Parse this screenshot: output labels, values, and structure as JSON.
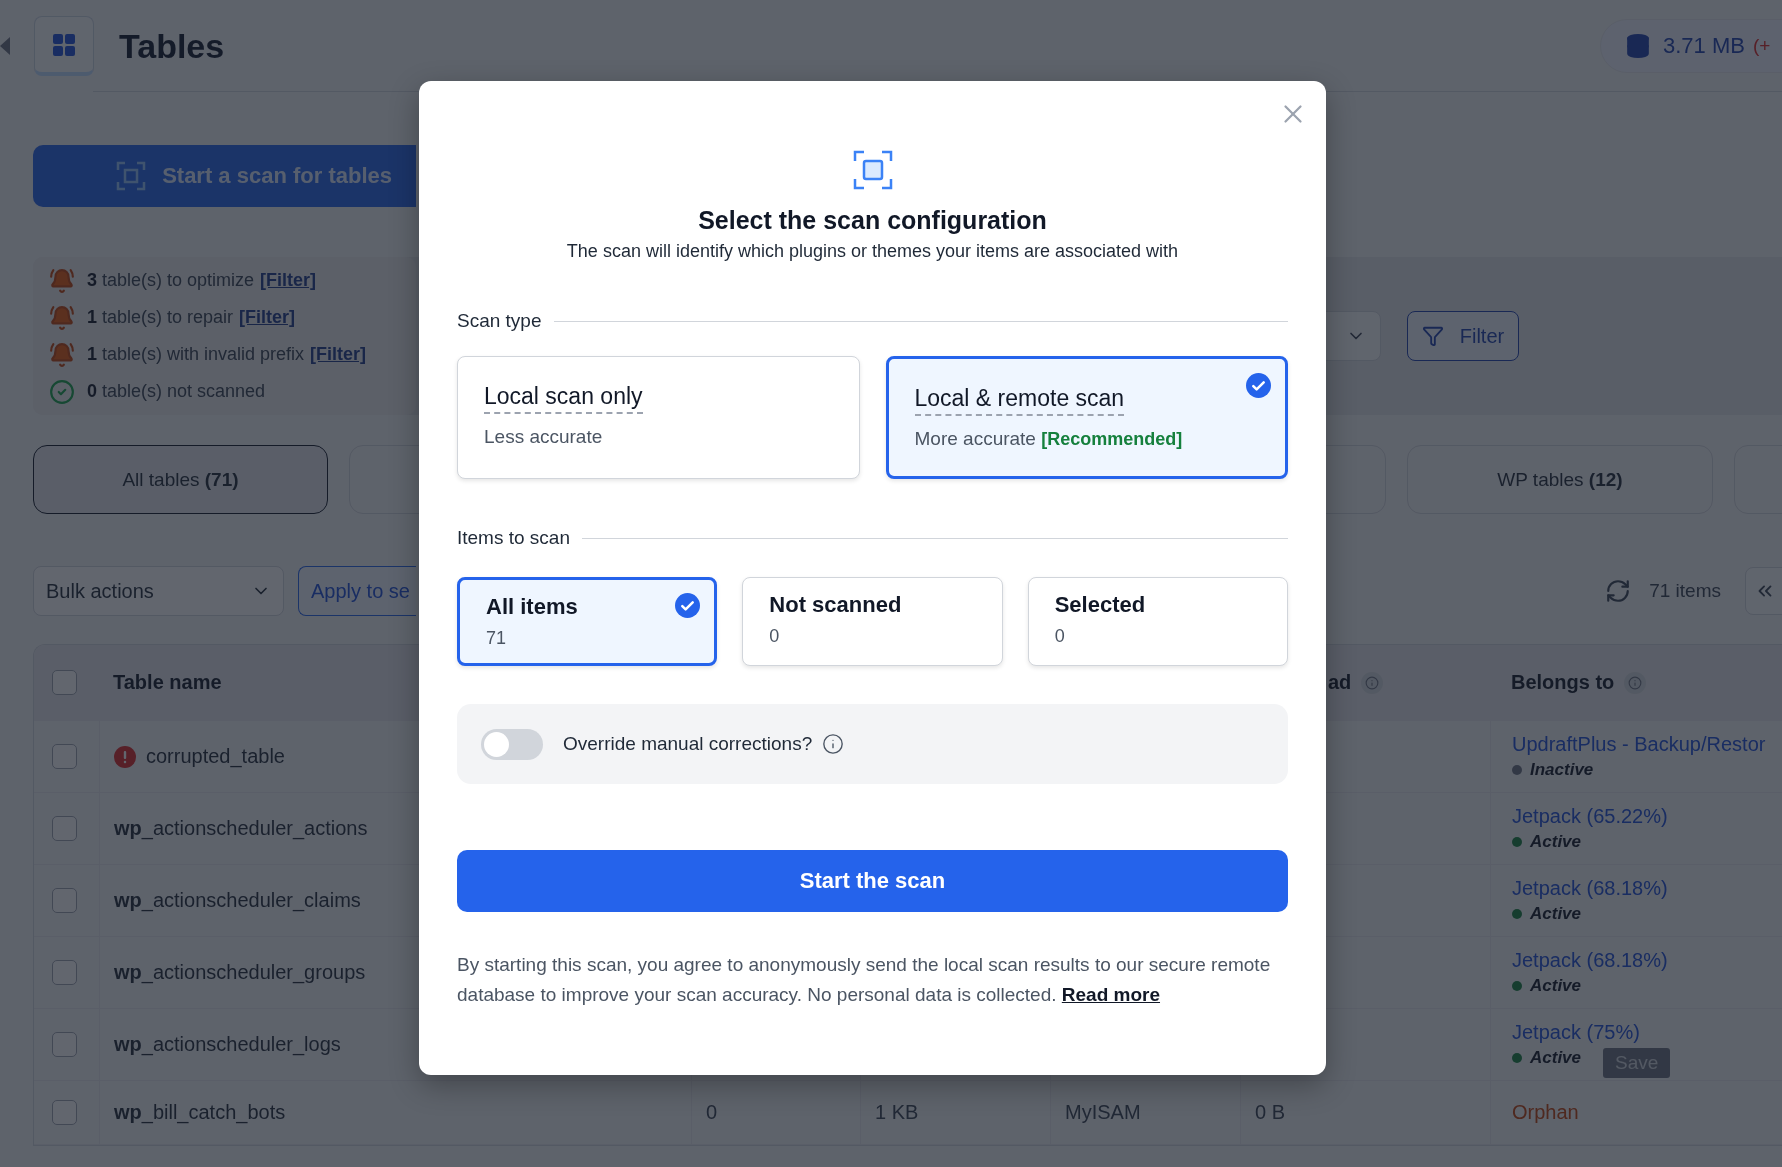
{
  "header": {
    "title": "Tables",
    "storage": "3.71 MB",
    "storage_delta": "(+"
  },
  "scan_button": "Start a scan for tables",
  "alerts": [
    {
      "kind": "warning",
      "count": "3",
      "text": "table(s) to optimize",
      "link": "[Filter]"
    },
    {
      "kind": "warning",
      "count": "1",
      "text": "table(s) to repair",
      "link": "[Filter]"
    },
    {
      "kind": "warning",
      "count": "1",
      "text": "table(s) with invalid prefix",
      "link": "[Filter]"
    },
    {
      "kind": "ok",
      "count": "0",
      "text": "table(s) not scanned"
    }
  ],
  "filter_button": "Filter",
  "tabs": [
    {
      "label": "All tables",
      "count": "(71)",
      "selected": true
    },
    {
      "selected": false
    },
    {
      "selected": false
    },
    {
      "label": "WP tables",
      "count": "(12)",
      "selected": false
    },
    {
      "selected": false
    }
  ],
  "bulk_actions": {
    "select": "Bulk actions",
    "apply": "Apply to se"
  },
  "item_count": "71 items",
  "table": {
    "header": {
      "name": "Table name",
      "column_5": "ad",
      "belongs_to": "Belongs to"
    },
    "select_all_checked": false,
    "rows": [
      {
        "name": "corrupted_table",
        "error": true,
        "checked": false,
        "belongs": {
          "kind": "plugin",
          "text": "UpdraftPlus - Backup/Restor",
          "status": "Inactive",
          "active": false
        }
      },
      {
        "name": "**wp**_actionscheduler_actions",
        "error": false,
        "checked": false,
        "belongs": {
          "kind": "plugin",
          "text": "Jetpack (65.22%)",
          "status": "Active",
          "active": true
        }
      },
      {
        "name": "**wp**_actionscheduler_claims",
        "error": false,
        "checked": false,
        "belongs": {
          "kind": "plugin",
          "text": "Jetpack (68.18%)",
          "status": "Active",
          "active": true
        }
      },
      {
        "name": "**wp**_actionscheduler_groups",
        "error": false,
        "checked": false,
        "belongs": {
          "kind": "plugin",
          "text": "Jetpack (68.18%)",
          "status": "Active",
          "active": true
        }
      },
      {
        "name": "**wp**_actionscheduler_logs",
        "error": false,
        "checked": false,
        "belongs": {
          "kind": "plugin",
          "text": "Jetpack (75%)",
          "status": "Active",
          "active": true
        },
        "save_button": "Save"
      },
      {
        "name": "**wp**_bill_catch_bots",
        "error": false,
        "checked": false,
        "cells": [
          "0",
          "1 KB",
          "MyISAM",
          "0 B"
        ],
        "belongs": {
          "kind": "orphan",
          "text": "Orphan"
        }
      }
    ]
  },
  "modal": {
    "title": "Select the scan configuration",
    "subtitle": "The scan will identify which plugins or themes your items are associated with",
    "scan_type_label": "Scan type",
    "scan_types": [
      {
        "title": "Local scan only",
        "description": "Less accurate",
        "selected": false
      },
      {
        "title": "Local & remote scan",
        "description": "More accurate",
        "tag": "[Recommended]",
        "selected": true
      }
    ],
    "items_label": "Items to scan",
    "items": [
      {
        "title": "All items",
        "count": "71",
        "selected": true
      },
      {
        "title": "Not scanned",
        "count": "0",
        "selected": false
      },
      {
        "title": "Selected",
        "count": "0",
        "selected": false
      }
    ],
    "override": {
      "label": "Override manual corrections?",
      "on": false
    },
    "start_button": "Start the scan",
    "disclaimer": "By starting this scan, you agree to anonymously send the local scan results to our secure remote database to improve your scan accuracy. No personal data is collected.",
    "read_more": "Read more"
  }
}
